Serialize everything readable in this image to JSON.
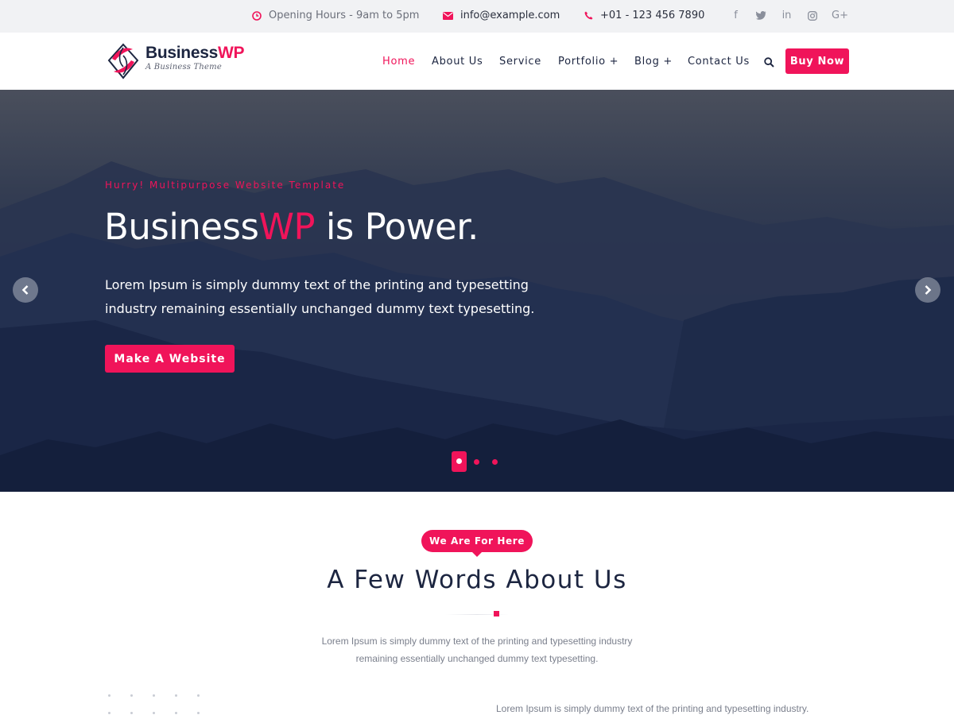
{
  "topbar": {
    "hours": "Opening Hours - 9am to 5pm",
    "email": "info@example.com",
    "phone": "+01 - 123 456 7890",
    "social": [
      {
        "icon": "facebook-icon",
        "glyph": "f"
      },
      {
        "icon": "twitter-icon",
        "glyph": "t"
      },
      {
        "icon": "linkedin-icon",
        "glyph": "in"
      },
      {
        "icon": "instagram-icon",
        "glyph": "◎"
      },
      {
        "icon": "google-plus-icon",
        "glyph": "G+"
      }
    ]
  },
  "header": {
    "brand_main": "Business",
    "brand_accent": "WP",
    "tagline": "A Business Theme",
    "nav": [
      {
        "label": "Home",
        "active": true
      },
      {
        "label": "About Us",
        "active": false
      },
      {
        "label": "Service",
        "active": false
      },
      {
        "label": "Portfolio +",
        "active": false
      },
      {
        "label": "Blog +",
        "active": false
      },
      {
        "label": "Contact Us",
        "active": false
      }
    ],
    "buy_label": "Buy Now"
  },
  "hero": {
    "eyebrow": "Hurry! Multipurpose Website Template",
    "title_main": "Business",
    "title_accent": "WP",
    "title_rest": " is Power.",
    "text": "Lorem Ipsum is simply dummy text of the printing and typesetting industry remaining essentially unchanged dummy text typesetting.",
    "button_label": "Make A Website",
    "slide_count": 3,
    "active_slide": 1
  },
  "about": {
    "pill_label": "We Are For Here",
    "title": "A Few Words About Us",
    "text_line1": "Lorem Ipsum is simply dummy text of the printing and typesetting industry",
    "text_line2": "remaining essentially unchanged dummy text typesetting.",
    "bottom_text": "Lorem Ipsum is simply dummy text of the printing and typesetting industry."
  },
  "colors": {
    "accent": "#f0145a",
    "dark": "#1c2540",
    "topbar_bg": "#f1f2f4"
  }
}
